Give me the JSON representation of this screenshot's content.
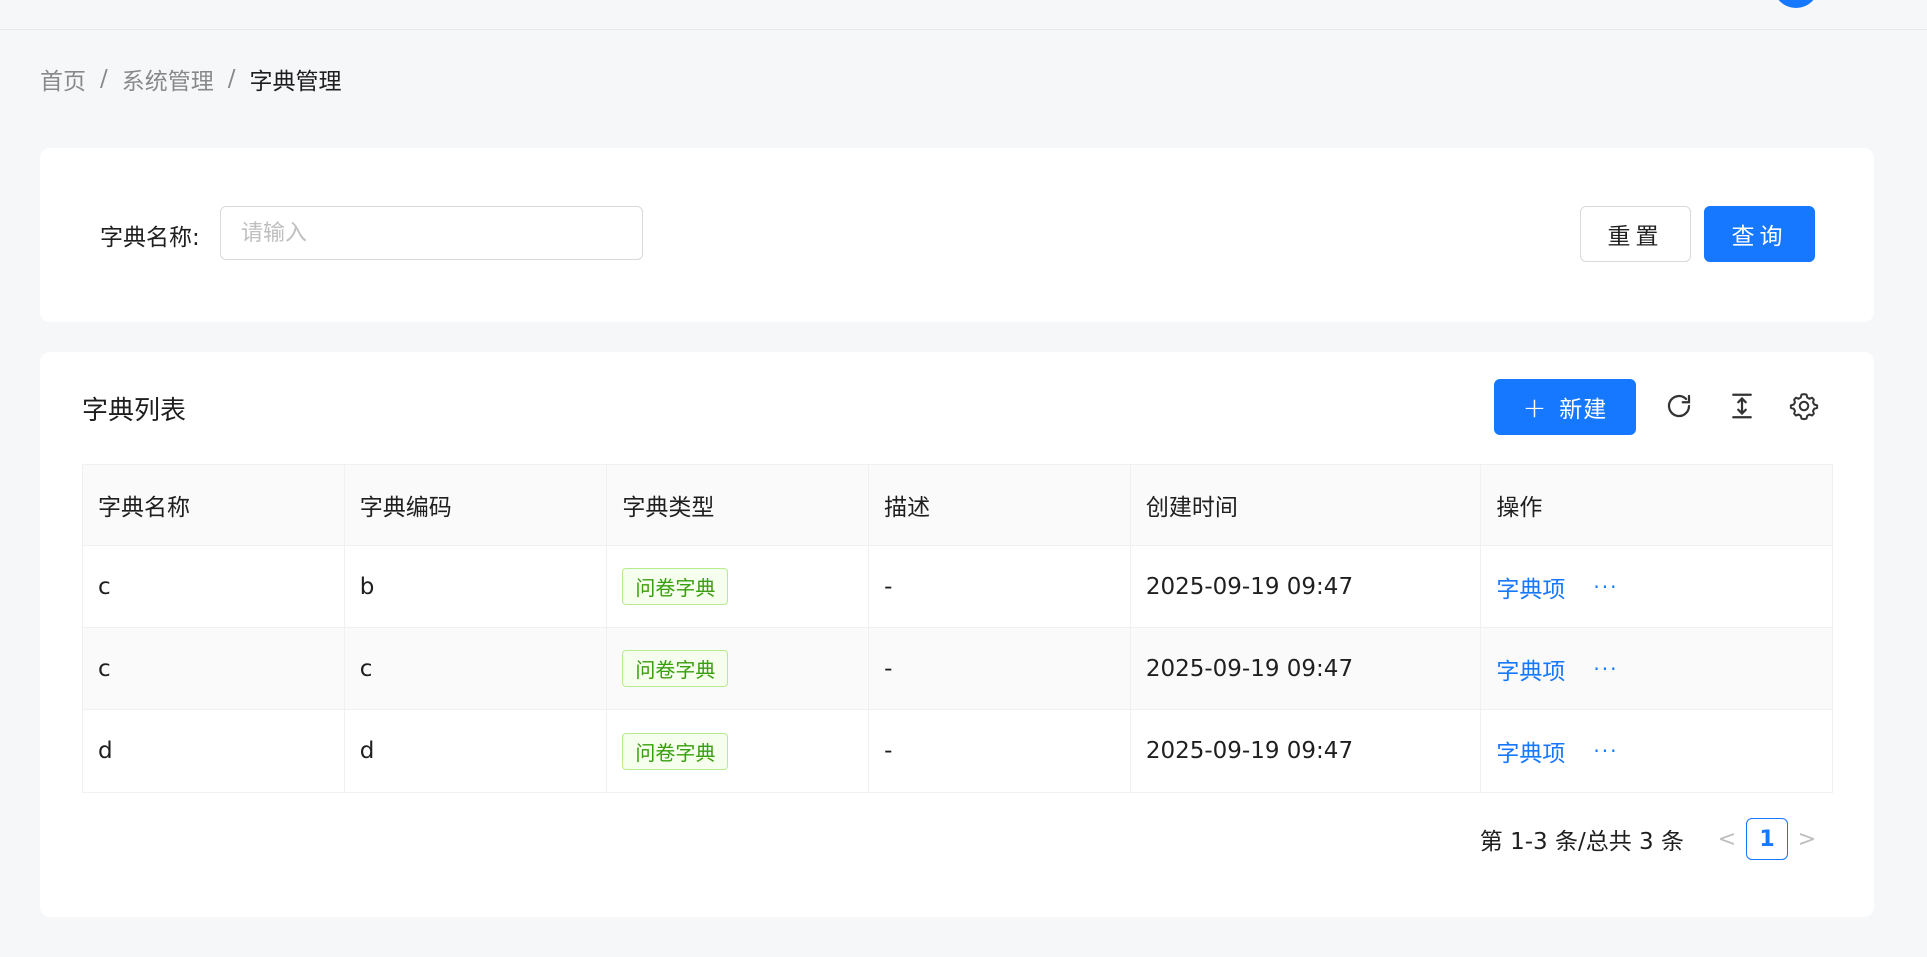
{
  "breadcrumb": {
    "items": [
      "首页",
      "系统管理",
      "字典管理"
    ],
    "separator": "/"
  },
  "search": {
    "label": "字典名称:",
    "placeholder": "请输入",
    "value": "",
    "reset_label": "重置",
    "query_label": "查询"
  },
  "list": {
    "title": "字典列表",
    "new_label": "新建",
    "icons": [
      "reload-icon",
      "column-height-icon",
      "setting-icon"
    ]
  },
  "table": {
    "columns": [
      "字典名称",
      "字典编码",
      "字典类型",
      "描述",
      "创建时间",
      "操作"
    ],
    "rows": [
      {
        "name": "c",
        "code": "b",
        "type": "问卷字典",
        "desc": "-",
        "created": "2025-09-19 09:47",
        "action": "字典项",
        "more": "···"
      },
      {
        "name": "c",
        "code": "c",
        "type": "问卷字典",
        "desc": "-",
        "created": "2025-09-19 09:47",
        "action": "字典项",
        "more": "···"
      },
      {
        "name": "d",
        "code": "d",
        "type": "问卷字典",
        "desc": "-",
        "created": "2025-09-19 09:47",
        "action": "字典项",
        "more": "···"
      }
    ]
  },
  "pagination": {
    "total_text": "第 1-3 条/总共 3 条",
    "prev": "<",
    "current_page": "1",
    "next": ">"
  },
  "colors": {
    "primary": "#1677ff",
    "tag_green": "#389e0d",
    "background": "#f6f7f9"
  }
}
